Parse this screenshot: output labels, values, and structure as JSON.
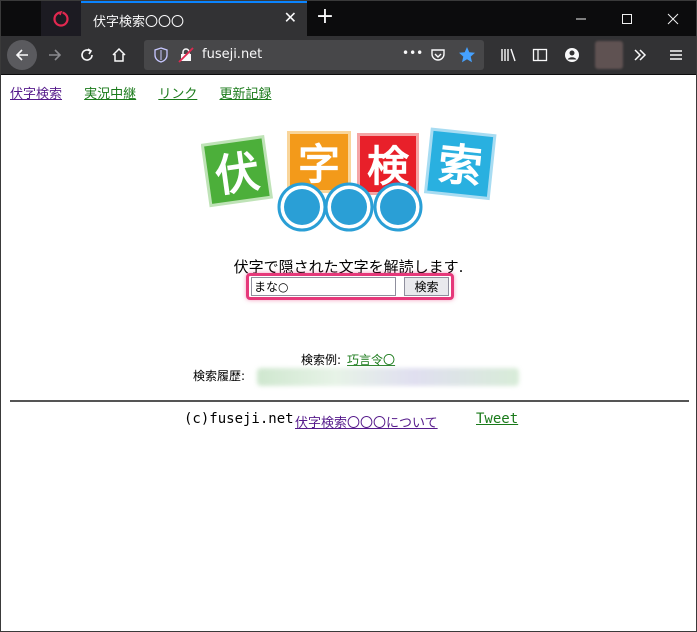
{
  "browser": {
    "tab_title": "伏字検索〇〇〇",
    "tab_close": "✕",
    "new_tab": "+",
    "url": "fuseji.net",
    "url_more": "•••"
  },
  "nav": {
    "items": [
      "伏字検索",
      "実況中継",
      "リンク",
      "更新記録"
    ]
  },
  "logo": {
    "tiles": [
      {
        "char": "伏",
        "color": "#4caf3a"
      },
      {
        "char": "字",
        "color": "#f39a1a"
      },
      {
        "char": "検",
        "color": "#e8202a"
      },
      {
        "char": "索",
        "color": "#29b0e0"
      }
    ],
    "circle_color": "#2a9fd6"
  },
  "main": {
    "tagline": "伏字で隠された文字を解読します.",
    "search_value": "まな○",
    "search_button": "検索",
    "example_label": "検索例:",
    "example_link": "巧言令〇",
    "history_label": "検索履歴:"
  },
  "footer": {
    "copyright": "(c)fuseji.net",
    "about_link": "伏字検索〇〇〇について",
    "tweet_link": "Tweet"
  },
  "colors": {
    "highlight": "#e6387a",
    "visited_link": "#551a8b",
    "link_green": "#1a7a1a"
  }
}
